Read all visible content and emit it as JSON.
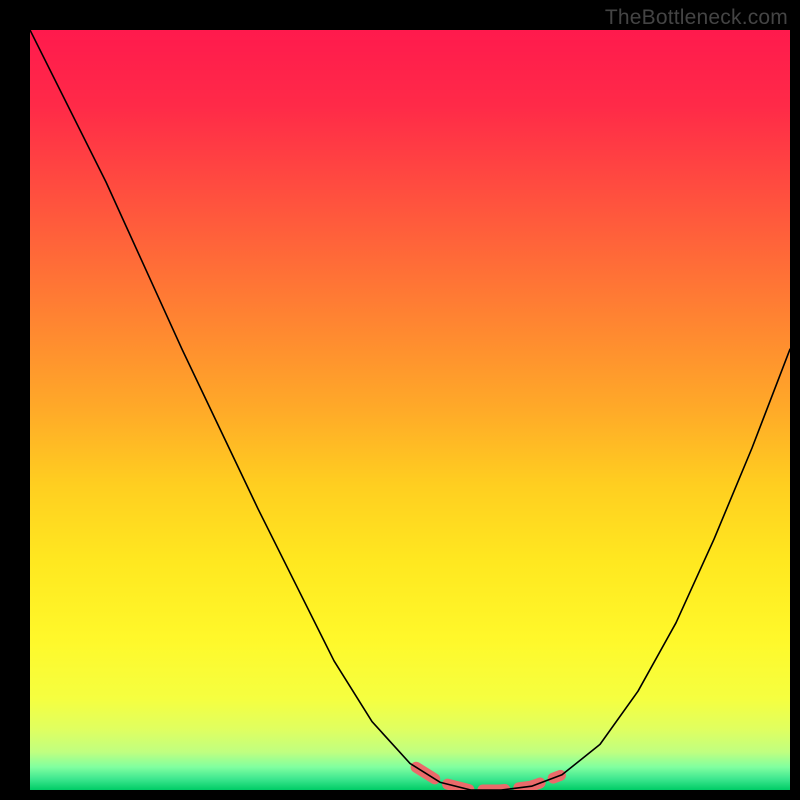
{
  "watermark": "TheBottleneck.com",
  "chart_data": {
    "type": "line",
    "title": "",
    "xlabel": "",
    "ylabel": "",
    "xlim": [
      0.0,
      1.0
    ],
    "ylim": [
      0.0,
      100.0
    ],
    "grid": false,
    "legend": false,
    "x": [
      0.0,
      0.05,
      0.1,
      0.15,
      0.2,
      0.25,
      0.3,
      0.35,
      0.4,
      0.45,
      0.5,
      0.54,
      0.58,
      0.62,
      0.66,
      0.7,
      0.75,
      0.8,
      0.85,
      0.9,
      0.95,
      1.0
    ],
    "y": [
      100.0,
      90.0,
      80.0,
      69.0,
      58.0,
      47.5,
      37.0,
      27.0,
      17.0,
      9.0,
      3.5,
      1.0,
      0.0,
      0.0,
      0.5,
      2.0,
      6.0,
      13.0,
      22.0,
      33.0,
      45.0,
      58.0
    ],
    "highlight_range": {
      "x_start": 0.508,
      "x_end": 0.7
    }
  }
}
